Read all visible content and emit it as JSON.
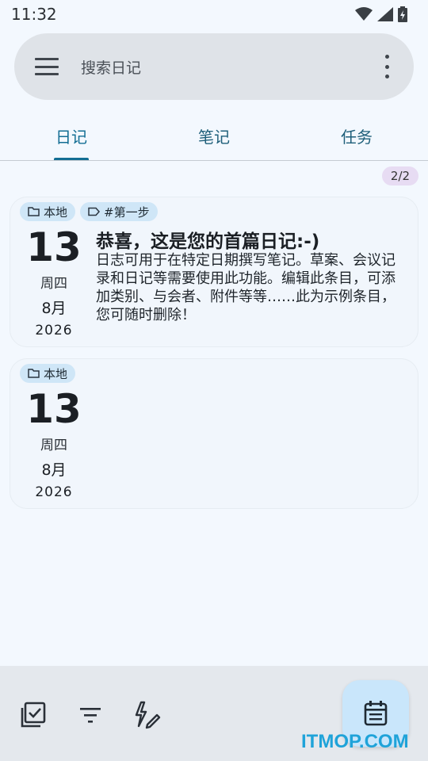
{
  "status": {
    "time": "11:32"
  },
  "search": {
    "placeholder": "搜索日记"
  },
  "tabs": [
    {
      "label": "日记"
    },
    {
      "label": "笔记"
    },
    {
      "label": "任务"
    }
  ],
  "list": {
    "count_badge": "2/2"
  },
  "entries": [
    {
      "chips": [
        {
          "label": "本地",
          "icon": "folder-icon"
        },
        {
          "label": "#第一步",
          "icon": "tag-icon"
        }
      ],
      "day": "13",
      "weekday": "周四",
      "month": "8月",
      "year": "2026",
      "title": "恭喜，这是您的首篇日记:-)",
      "body": "日志可用于在特定日期撰写笔记。草案、会议记录和日记等需要使用此功能。编辑此条目，可添加类别、与会者、附件等等……此为示例条目，您可随时删除！"
    },
    {
      "chips": [
        {
          "label": "本地",
          "icon": "folder-icon"
        }
      ],
      "day": "13",
      "weekday": "周四",
      "month": "8月",
      "year": "2026",
      "title": "",
      "body": ""
    }
  ],
  "bottom_bar": {
    "icons": [
      "checklist-icon",
      "filter-icon",
      "quick-edit-icon"
    ],
    "fab_icon": "journal-add-icon"
  },
  "watermark": "ITMOP.COM",
  "colors": {
    "accent": "#136e94",
    "chip_bg": "#cfe6f7",
    "fab_bg": "#c9e6fb",
    "badge_bg": "#e7dcf3"
  }
}
